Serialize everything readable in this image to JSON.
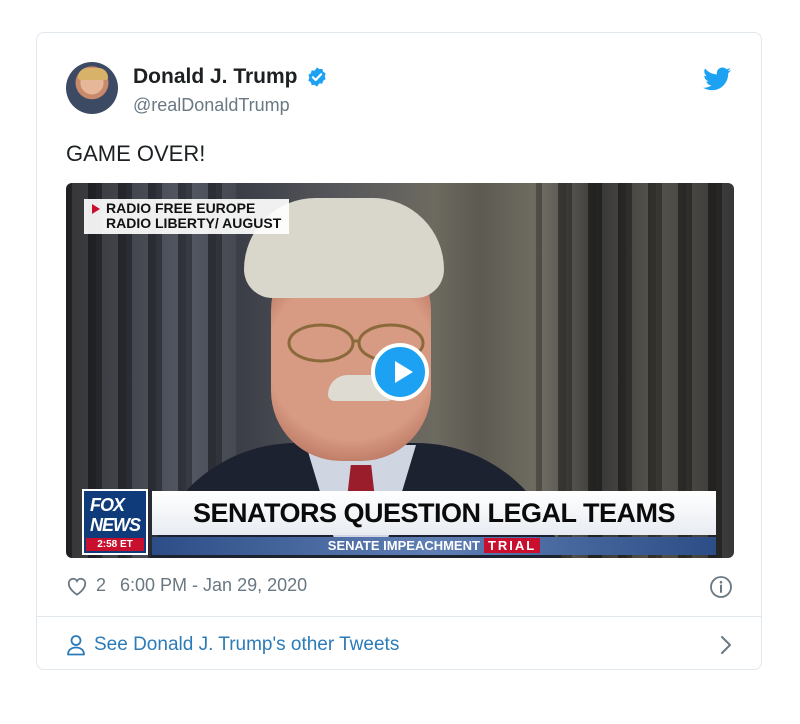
{
  "tweet": {
    "author_name": "Donald J. Trump",
    "handle": "@realDonaldTrump",
    "text": "GAME OVER!",
    "like_count": "2",
    "timestamp": "6:00 PM - Jan 29, 2020"
  },
  "media": {
    "source_line1": "RADIO FREE EUROPE",
    "source_line2": "RADIO LIBERTY/ AUGUST",
    "network_logo_line1": "FOX",
    "network_logo_line2": "NEWS",
    "network_time": "2:58 ET",
    "headline": "SENATORS QUESTION LEGAL TEAMS",
    "subheadline": "SENATE IMPEACHMENT",
    "subheadline_tag": "TRIAL"
  },
  "footer": {
    "other_tweets_label": "See Donald J. Trump's other Tweets"
  },
  "colors": {
    "twitter_blue": "#1da1f2",
    "link_blue": "#2b7bb9",
    "muted_text": "#697882",
    "fox_red": "#c8102e",
    "fox_navy": "#0f3b7a"
  },
  "icons": [
    "verified-badge-icon",
    "twitter-bird-icon",
    "play-icon",
    "heart-icon",
    "info-icon",
    "user-icon",
    "chevron-right-icon"
  ]
}
